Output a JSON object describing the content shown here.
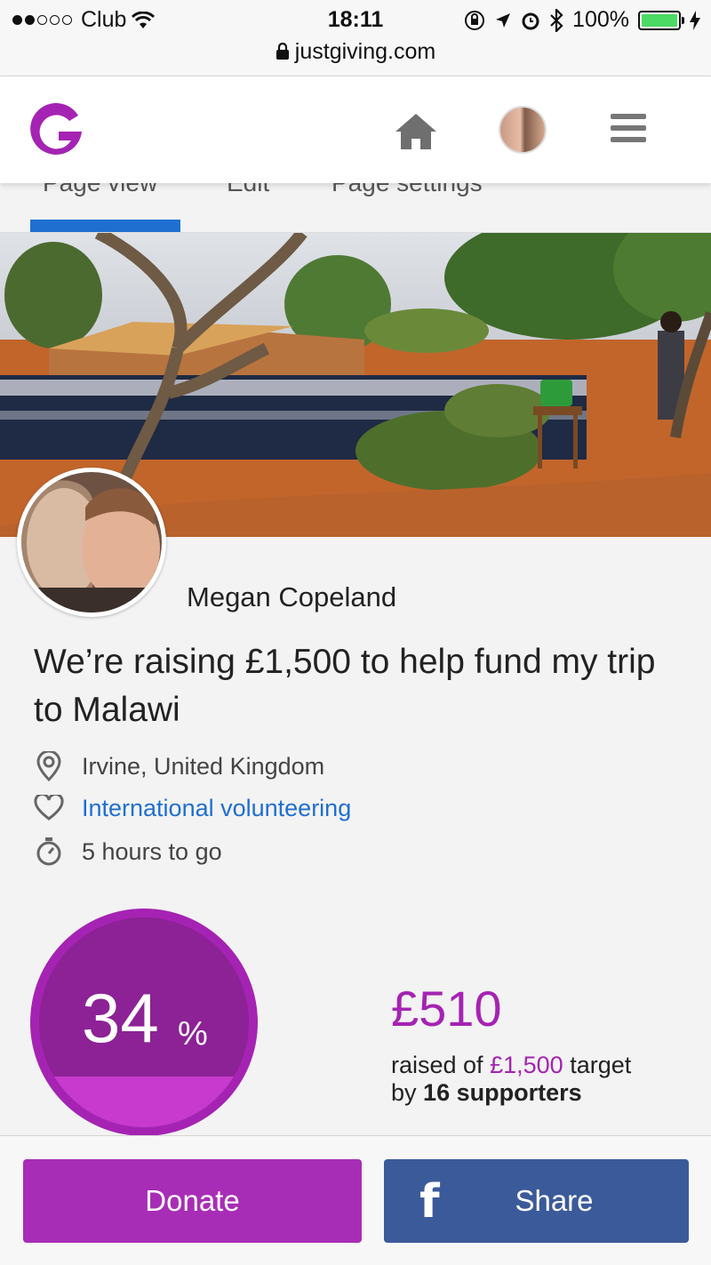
{
  "status_bar": {
    "carrier": "Club",
    "time": "18:11",
    "battery": "100%",
    "url": "justgiving.com"
  },
  "tabs": [
    "Page view",
    "Edit",
    "Page settings"
  ],
  "fundraiser": {
    "name": "Megan Copeland",
    "headline": "We’re raising £1,500 to help fund my trip to Malawi",
    "location": "Irvine, United Kingdom",
    "cause": "International volunteering",
    "time_left": "5 hours to go"
  },
  "progress": {
    "percent": "34",
    "percent_sign": "%",
    "percent_value": 0.34,
    "amount_raised": "£510",
    "raised_of": "raised of",
    "target": "£1,500",
    "target_suffix": "target",
    "by": "by",
    "supporters": "16 supporters"
  },
  "actions": {
    "donate": "Donate",
    "share": "Share"
  },
  "colors": {
    "brand": "#a523b3",
    "link": "#1f6fd1",
    "facebook": "#3b5a9a"
  }
}
